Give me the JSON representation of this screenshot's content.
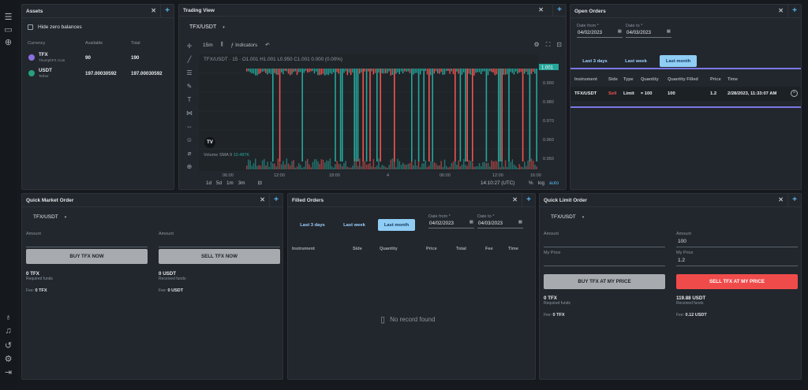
{
  "rail": {
    "icons": [
      "menu-icon",
      "window-icon",
      "add-circle-icon",
      "bulb-icon",
      "bell-icon",
      "history-icon",
      "settings-icon",
      "logout-icon"
    ]
  },
  "assets": {
    "title": "Assets",
    "hide_zero": "Hide zero balances",
    "columns": [
      "Currency",
      "Available",
      "Total"
    ],
    "rows": [
      {
        "symbol": "TFX",
        "name": "TriumphFX Coin",
        "available": "90",
        "total": "190",
        "icon_color": "#8b6fe0"
      },
      {
        "symbol": "USDT",
        "name": "Tether",
        "available": "197.00030592",
        "total": "197.00030592",
        "icon_color": "#26a17b"
      }
    ]
  },
  "trading": {
    "title": "Trading View",
    "pair": "TFX/USDT",
    "interval": "15m",
    "indicators": "Indicators",
    "ohlc": "TFX/USDT · 15 · O1.001 H1.001 L0.950 C1.001 0.000 (0.00%)",
    "volume_label": "Volume SMA 9",
    "volume_value": "10.487K",
    "price_badge": "1.001",
    "price_axis": [
      "0.990",
      "0.980",
      "0.970",
      "0.960",
      "0.950"
    ],
    "time_axis": [
      "06:00",
      "12:00",
      "18:00",
      "4",
      "06:00",
      "12:00",
      "16:00"
    ],
    "ranges": [
      "1d",
      "5d",
      "1m",
      "3m"
    ],
    "clock": "14:10:27 (UTC)",
    "scale_options": [
      "%",
      "log",
      "auto"
    ]
  },
  "open_orders": {
    "title": "Open Orders",
    "date_from_label": "Date from *",
    "date_from": "04/02/2023",
    "date_to_label": "Date to *",
    "date_to": "04/03/2023",
    "tabs": [
      "Last 3 days",
      "Last week",
      "Last month"
    ],
    "active_tab": 2,
    "columns": [
      "Instrument",
      "Side",
      "Type",
      "Quantity",
      "Quantity Filled",
      "Price",
      "Time"
    ],
    "rows": [
      {
        "instrument": "TFX/USDT",
        "side": "Sell",
        "type": "Limit",
        "quantity": "≈ 100",
        "filled": "100",
        "price": "1.2",
        "time": "2/28/2023, 11:33:07 AM"
      }
    ]
  },
  "quick_market": {
    "title": "Quick Market Order",
    "pair": "TFX/USDT",
    "amount_label": "Amount",
    "buy_label": "BUY TFX NOW",
    "sell_label": "SELL TFX NOW",
    "req_value": "0",
    "req_unit": "TFX",
    "req_label": "Required funds",
    "recv_value": "0",
    "recv_unit": "USDT",
    "recv_label": "Received funds",
    "fee_label": "Fee:",
    "fee_left": "0",
    "fee_left_unit": "TFX",
    "fee_right": "0",
    "fee_right_unit": "USDT"
  },
  "filled": {
    "title": "Filled Orders",
    "tabs": [
      "Last 3 days",
      "Last week",
      "Last month"
    ],
    "active_tab": 2,
    "date_from_label": "Date from *",
    "date_from": "04/02/2023",
    "date_to_label": "Date to *",
    "date_to": "04/03/2023",
    "columns": [
      "Instrument",
      "Side",
      "Quantity",
      "Price",
      "Total",
      "Fee",
      "Time"
    ],
    "empty": "No record found"
  },
  "quick_limit": {
    "title": "Quick Limit Order",
    "pair": "TFX/USDT",
    "amount_label": "Amount",
    "amount_right": "100",
    "myprice_label": "My Price",
    "myprice_right": "1.2",
    "buy_label": "BUY TFX AT MY PRICE",
    "sell_label": "SELL TFX AT MY PRICE",
    "req_value": "0",
    "req_unit": "TFX",
    "req_label": "Required funds",
    "recv_value": "119.88",
    "recv_unit": "USDT",
    "recv_label": "Received funds",
    "fee_label": "Fee:",
    "fee_left": "0",
    "fee_left_unit": "TFX",
    "fee_right": "0.12",
    "fee_right_unit": "USDT"
  },
  "colors": {
    "up": "#26a69a",
    "down": "#ef5350",
    "accent": "#57b4f0",
    "highlight": "#7b78e6",
    "sell_btn": "#f04b4b"
  }
}
